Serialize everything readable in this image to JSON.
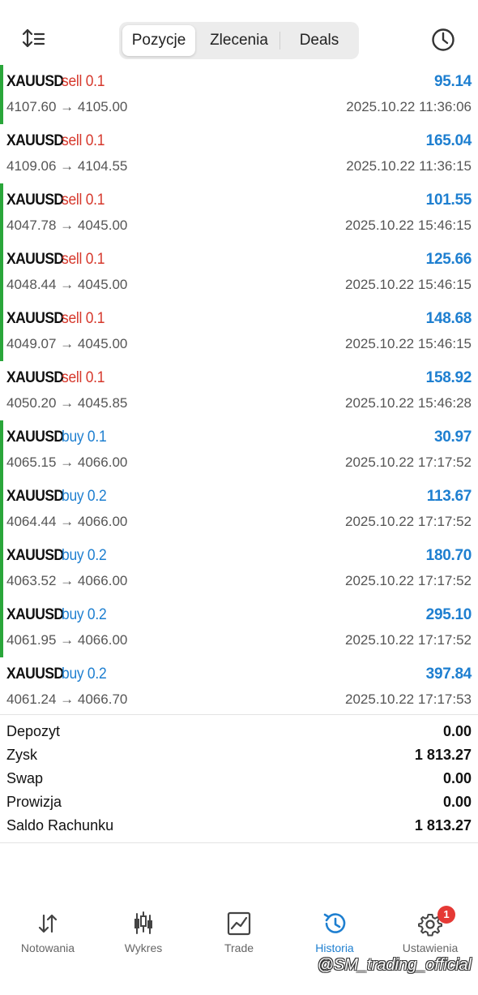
{
  "segment": {
    "tabs": [
      "Pozycje",
      "Zlecenia",
      "Deals"
    ],
    "active": "Pozycje"
  },
  "icons": {
    "sort": "sort-icon",
    "history_clock": "clock-icon"
  },
  "colors": {
    "sell": "#d6382c",
    "buy": "#1e7fd0",
    "profit": "#1e7fd0",
    "marker": "#2aa63a",
    "badge": "#e53935"
  },
  "trades": [
    {
      "symbol": "XAUUSD",
      "side": "sell",
      "volume": "sell 0.1",
      "profit": "95.14",
      "prices": "4107.60 → 4105.00",
      "time": "2025.10.22 11:36:06",
      "marked": true
    },
    {
      "symbol": "XAUUSD",
      "side": "sell",
      "volume": "sell 0.1",
      "profit": "165.04",
      "prices": "4109.06 → 4104.55",
      "time": "2025.10.22 11:36:15",
      "marked": false
    },
    {
      "symbol": "XAUUSD",
      "side": "sell",
      "volume": "sell 0.1",
      "profit": "101.55",
      "prices": "4047.78 → 4045.00",
      "time": "2025.10.22 15:46:15",
      "marked": true
    },
    {
      "symbol": "XAUUSD",
      "side": "sell",
      "volume": "sell 0.1",
      "profit": "125.66",
      "prices": "4048.44 → 4045.00",
      "time": "2025.10.22 15:46:15",
      "marked": true
    },
    {
      "symbol": "XAUUSD",
      "side": "sell",
      "volume": "sell 0.1",
      "profit": "148.68",
      "prices": "4049.07 → 4045.00",
      "time": "2025.10.22 15:46:15",
      "marked": true
    },
    {
      "symbol": "XAUUSD",
      "side": "sell",
      "volume": "sell 0.1",
      "profit": "158.92",
      "prices": "4050.20 → 4045.85",
      "time": "2025.10.22 15:46:28",
      "marked": false
    },
    {
      "symbol": "XAUUSD",
      "side": "buy",
      "volume": "buy 0.1",
      "profit": "30.97",
      "prices": "4065.15 → 4066.00",
      "time": "2025.10.22 17:17:52",
      "marked": true
    },
    {
      "symbol": "XAUUSD",
      "side": "buy",
      "volume": "buy 0.2",
      "profit": "113.67",
      "prices": "4064.44 → 4066.00",
      "time": "2025.10.22 17:17:52",
      "marked": true
    },
    {
      "symbol": "XAUUSD",
      "side": "buy",
      "volume": "buy 0.2",
      "profit": "180.70",
      "prices": "4063.52 → 4066.00",
      "time": "2025.10.22 17:17:52",
      "marked": true
    },
    {
      "symbol": "XAUUSD",
      "side": "buy",
      "volume": "buy 0.2",
      "profit": "295.10",
      "prices": "4061.95 → 4066.00",
      "time": "2025.10.22 17:17:52",
      "marked": true
    },
    {
      "symbol": "XAUUSD",
      "side": "buy",
      "volume": "buy 0.2",
      "profit": "397.84",
      "prices": "4061.24 → 4066.70",
      "time": "2025.10.22 17:17:53",
      "marked": false
    }
  ],
  "summary": [
    {
      "label": "Depozyt",
      "value": "0.00"
    },
    {
      "label": "Zysk",
      "value": "1 813.27"
    },
    {
      "label": "Swap",
      "value": "0.00"
    },
    {
      "label": "Prowizja",
      "value": "0.00"
    },
    {
      "label": "Saldo Rachunku",
      "value": "1 813.27"
    }
  ],
  "tabbar": {
    "items": [
      {
        "label": "Notowania",
        "icon": "quotes-arrows-icon"
      },
      {
        "label": "Wykres",
        "icon": "candlestick-chart-icon"
      },
      {
        "label": "Trade",
        "icon": "trade-chart-icon"
      },
      {
        "label": "Historia",
        "icon": "history-icon"
      },
      {
        "label": "Ustawienia",
        "icon": "settings-gear-icon"
      }
    ],
    "active": "Historia",
    "badge": "1"
  },
  "watermark": "@SM_trading_official"
}
